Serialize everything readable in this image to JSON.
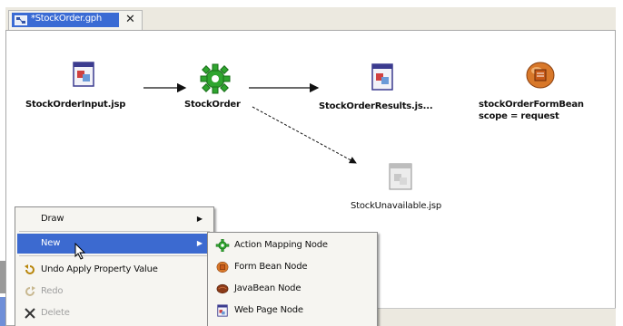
{
  "editor_tab": {
    "title": "*StockOrder.gph",
    "close_glyph": "✕",
    "icon": "diagram-file-icon"
  },
  "nodes": [
    {
      "id": "stockorderinput",
      "label": "StockOrderInput.jsp",
      "icon": "jsp-page-icon"
    },
    {
      "id": "stockorder",
      "label": "StockOrder",
      "icon": "action-mapping-gear-icon"
    },
    {
      "id": "stockorderresults",
      "label": "StockOrderResults.js...",
      "icon": "jsp-page-icon"
    },
    {
      "id": "stockorderformbean",
      "label_line1": "stockOrderFormBean",
      "label_line2": "scope = request",
      "icon": "form-bean-icon"
    },
    {
      "id": "stockunavailable",
      "label": "StockUnavailable.jsp",
      "icon": "jsp-page-disabled-icon"
    }
  ],
  "context_menu": {
    "items": [
      {
        "label": "Draw",
        "has_submenu": true,
        "selected": false,
        "disabled": false,
        "icon": ""
      },
      {
        "label": "New",
        "has_submenu": true,
        "selected": true,
        "disabled": false,
        "icon": ""
      },
      {
        "label": "Undo Apply Property Value",
        "has_submenu": false,
        "selected": false,
        "disabled": false,
        "icon": "undo-icon"
      },
      {
        "label": "Redo",
        "has_submenu": false,
        "selected": false,
        "disabled": true,
        "icon": "redo-icon"
      },
      {
        "label": "Delete",
        "has_submenu": false,
        "selected": false,
        "disabled": true,
        "icon": "delete-x-icon"
      }
    ],
    "arrow_glyph": "▶"
  },
  "new_submenu": {
    "items": [
      {
        "label": "Action Mapping Node",
        "icon": "action-mapping-gear-icon"
      },
      {
        "label": "Form Bean Node",
        "icon": "form-bean-icon"
      },
      {
        "label": "JavaBean Node",
        "icon": "javabean-icon"
      },
      {
        "label": "Web Page Node",
        "icon": "web-page-icon"
      }
    ]
  },
  "colors": {
    "selection_blue": "#3c6ad0",
    "gear_green": "#2fa52f",
    "bean_orange": "#d8782a",
    "javabean_brown": "#8a3a18"
  }
}
